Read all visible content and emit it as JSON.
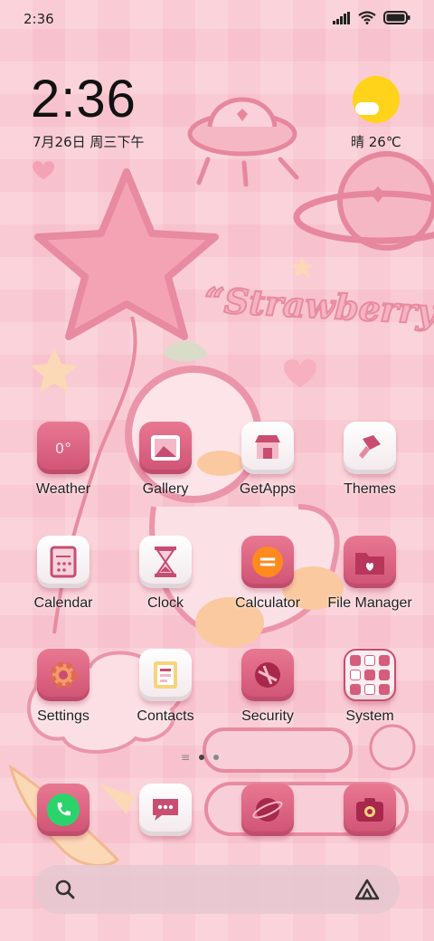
{
  "status_bar": {
    "time": "2:36"
  },
  "clock_widget": {
    "time": "2:36",
    "date": "7月26日 周三下午"
  },
  "weather_widget": {
    "text": "晴 26℃"
  },
  "wallpaper": {
    "title": "“Strawberry”"
  },
  "apps": [
    {
      "label": "Weather",
      "icon": "weather-icon",
      "glyph": "0°"
    },
    {
      "label": "Gallery",
      "icon": "gallery-icon"
    },
    {
      "label": "GetApps",
      "icon": "getapps-icon"
    },
    {
      "label": "Themes",
      "icon": "themes-icon"
    },
    {
      "label": "Calendar",
      "icon": "calendar-icon"
    },
    {
      "label": "Clock",
      "icon": "clock-icon"
    },
    {
      "label": "Calculator",
      "icon": "calculator-icon",
      "glyph": "="
    },
    {
      "label": "File Manager",
      "icon": "file-manager-icon"
    },
    {
      "label": "Settings",
      "icon": "settings-icon"
    },
    {
      "label": "Contacts",
      "icon": "contacts-icon"
    },
    {
      "label": "Security",
      "icon": "security-icon"
    },
    {
      "label": "System",
      "icon": "system-folder-icon"
    }
  ],
  "dock": [
    {
      "icon": "phone-icon"
    },
    {
      "icon": "messages-icon"
    },
    {
      "icon": "browser-icon"
    },
    {
      "icon": "camera-icon"
    }
  ],
  "colors": {
    "accent_pink": "#d65c7c",
    "sun": "#ffd319",
    "phone_green": "#2bd46a"
  }
}
